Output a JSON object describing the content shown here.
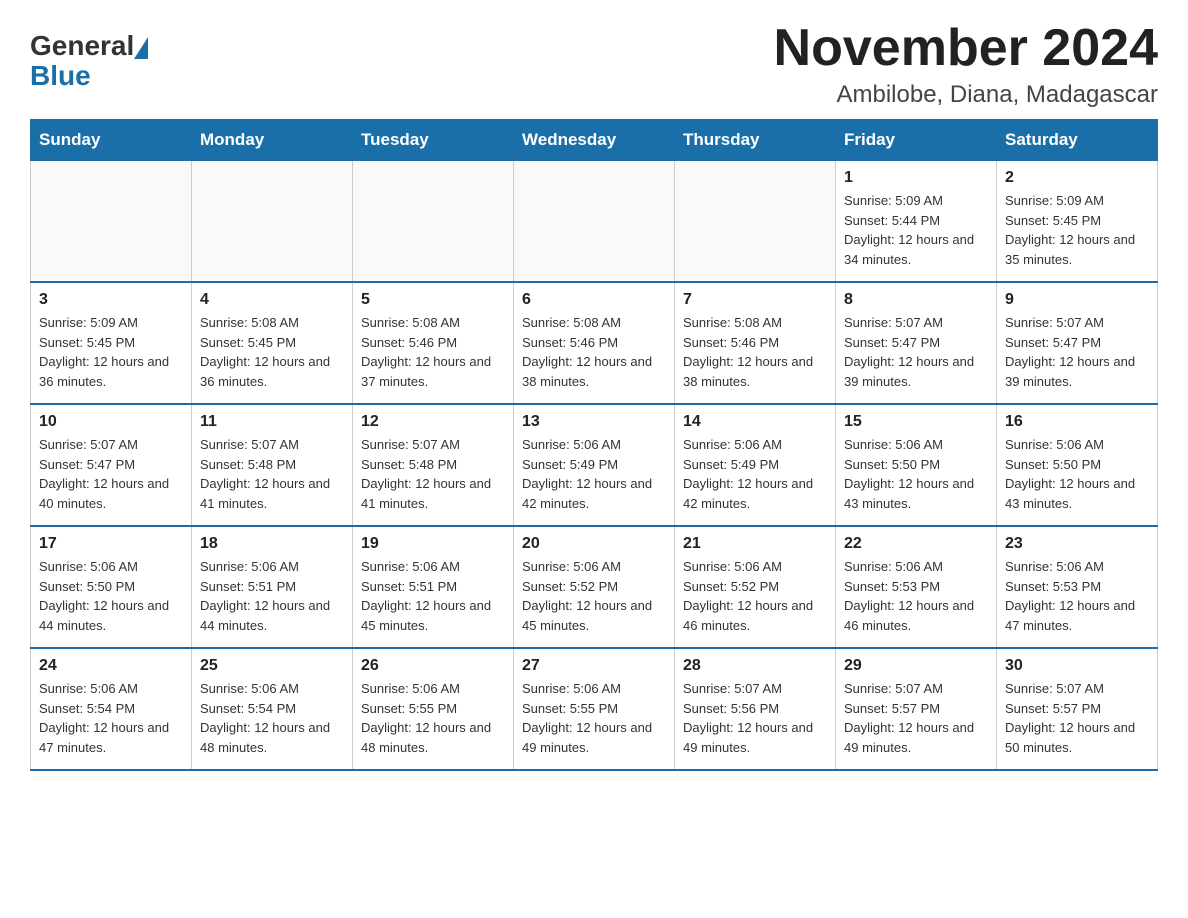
{
  "logo": {
    "text_general": "General",
    "text_blue": "Blue"
  },
  "title": "November 2024",
  "subtitle": "Ambilobe, Diana, Madagascar",
  "days_of_week": [
    "Sunday",
    "Monday",
    "Tuesday",
    "Wednesday",
    "Thursday",
    "Friday",
    "Saturday"
  ],
  "weeks": [
    [
      {
        "day": "",
        "sunrise": "",
        "sunset": "",
        "daylight": "",
        "empty": true
      },
      {
        "day": "",
        "sunrise": "",
        "sunset": "",
        "daylight": "",
        "empty": true
      },
      {
        "day": "",
        "sunrise": "",
        "sunset": "",
        "daylight": "",
        "empty": true
      },
      {
        "day": "",
        "sunrise": "",
        "sunset": "",
        "daylight": "",
        "empty": true
      },
      {
        "day": "",
        "sunrise": "",
        "sunset": "",
        "daylight": "",
        "empty": true
      },
      {
        "day": "1",
        "sunrise": "Sunrise: 5:09 AM",
        "sunset": "Sunset: 5:44 PM",
        "daylight": "Daylight: 12 hours and 34 minutes.",
        "empty": false
      },
      {
        "day": "2",
        "sunrise": "Sunrise: 5:09 AM",
        "sunset": "Sunset: 5:45 PM",
        "daylight": "Daylight: 12 hours and 35 minutes.",
        "empty": false
      }
    ],
    [
      {
        "day": "3",
        "sunrise": "Sunrise: 5:09 AM",
        "sunset": "Sunset: 5:45 PM",
        "daylight": "Daylight: 12 hours and 36 minutes.",
        "empty": false
      },
      {
        "day": "4",
        "sunrise": "Sunrise: 5:08 AM",
        "sunset": "Sunset: 5:45 PM",
        "daylight": "Daylight: 12 hours and 36 minutes.",
        "empty": false
      },
      {
        "day": "5",
        "sunrise": "Sunrise: 5:08 AM",
        "sunset": "Sunset: 5:46 PM",
        "daylight": "Daylight: 12 hours and 37 minutes.",
        "empty": false
      },
      {
        "day": "6",
        "sunrise": "Sunrise: 5:08 AM",
        "sunset": "Sunset: 5:46 PM",
        "daylight": "Daylight: 12 hours and 38 minutes.",
        "empty": false
      },
      {
        "day": "7",
        "sunrise": "Sunrise: 5:08 AM",
        "sunset": "Sunset: 5:46 PM",
        "daylight": "Daylight: 12 hours and 38 minutes.",
        "empty": false
      },
      {
        "day": "8",
        "sunrise": "Sunrise: 5:07 AM",
        "sunset": "Sunset: 5:47 PM",
        "daylight": "Daylight: 12 hours and 39 minutes.",
        "empty": false
      },
      {
        "day": "9",
        "sunrise": "Sunrise: 5:07 AM",
        "sunset": "Sunset: 5:47 PM",
        "daylight": "Daylight: 12 hours and 39 minutes.",
        "empty": false
      }
    ],
    [
      {
        "day": "10",
        "sunrise": "Sunrise: 5:07 AM",
        "sunset": "Sunset: 5:47 PM",
        "daylight": "Daylight: 12 hours and 40 minutes.",
        "empty": false
      },
      {
        "day": "11",
        "sunrise": "Sunrise: 5:07 AM",
        "sunset": "Sunset: 5:48 PM",
        "daylight": "Daylight: 12 hours and 41 minutes.",
        "empty": false
      },
      {
        "day": "12",
        "sunrise": "Sunrise: 5:07 AM",
        "sunset": "Sunset: 5:48 PM",
        "daylight": "Daylight: 12 hours and 41 minutes.",
        "empty": false
      },
      {
        "day": "13",
        "sunrise": "Sunrise: 5:06 AM",
        "sunset": "Sunset: 5:49 PM",
        "daylight": "Daylight: 12 hours and 42 minutes.",
        "empty": false
      },
      {
        "day": "14",
        "sunrise": "Sunrise: 5:06 AM",
        "sunset": "Sunset: 5:49 PM",
        "daylight": "Daylight: 12 hours and 42 minutes.",
        "empty": false
      },
      {
        "day": "15",
        "sunrise": "Sunrise: 5:06 AM",
        "sunset": "Sunset: 5:50 PM",
        "daylight": "Daylight: 12 hours and 43 minutes.",
        "empty": false
      },
      {
        "day": "16",
        "sunrise": "Sunrise: 5:06 AM",
        "sunset": "Sunset: 5:50 PM",
        "daylight": "Daylight: 12 hours and 43 minutes.",
        "empty": false
      }
    ],
    [
      {
        "day": "17",
        "sunrise": "Sunrise: 5:06 AM",
        "sunset": "Sunset: 5:50 PM",
        "daylight": "Daylight: 12 hours and 44 minutes.",
        "empty": false
      },
      {
        "day": "18",
        "sunrise": "Sunrise: 5:06 AM",
        "sunset": "Sunset: 5:51 PM",
        "daylight": "Daylight: 12 hours and 44 minutes.",
        "empty": false
      },
      {
        "day": "19",
        "sunrise": "Sunrise: 5:06 AM",
        "sunset": "Sunset: 5:51 PM",
        "daylight": "Daylight: 12 hours and 45 minutes.",
        "empty": false
      },
      {
        "day": "20",
        "sunrise": "Sunrise: 5:06 AM",
        "sunset": "Sunset: 5:52 PM",
        "daylight": "Daylight: 12 hours and 45 minutes.",
        "empty": false
      },
      {
        "day": "21",
        "sunrise": "Sunrise: 5:06 AM",
        "sunset": "Sunset: 5:52 PM",
        "daylight": "Daylight: 12 hours and 46 minutes.",
        "empty": false
      },
      {
        "day": "22",
        "sunrise": "Sunrise: 5:06 AM",
        "sunset": "Sunset: 5:53 PM",
        "daylight": "Daylight: 12 hours and 46 minutes.",
        "empty": false
      },
      {
        "day": "23",
        "sunrise": "Sunrise: 5:06 AM",
        "sunset": "Sunset: 5:53 PM",
        "daylight": "Daylight: 12 hours and 47 minutes.",
        "empty": false
      }
    ],
    [
      {
        "day": "24",
        "sunrise": "Sunrise: 5:06 AM",
        "sunset": "Sunset: 5:54 PM",
        "daylight": "Daylight: 12 hours and 47 minutes.",
        "empty": false
      },
      {
        "day": "25",
        "sunrise": "Sunrise: 5:06 AM",
        "sunset": "Sunset: 5:54 PM",
        "daylight": "Daylight: 12 hours and 48 minutes.",
        "empty": false
      },
      {
        "day": "26",
        "sunrise": "Sunrise: 5:06 AM",
        "sunset": "Sunset: 5:55 PM",
        "daylight": "Daylight: 12 hours and 48 minutes.",
        "empty": false
      },
      {
        "day": "27",
        "sunrise": "Sunrise: 5:06 AM",
        "sunset": "Sunset: 5:55 PM",
        "daylight": "Daylight: 12 hours and 49 minutes.",
        "empty": false
      },
      {
        "day": "28",
        "sunrise": "Sunrise: 5:07 AM",
        "sunset": "Sunset: 5:56 PM",
        "daylight": "Daylight: 12 hours and 49 minutes.",
        "empty": false
      },
      {
        "day": "29",
        "sunrise": "Sunrise: 5:07 AM",
        "sunset": "Sunset: 5:57 PM",
        "daylight": "Daylight: 12 hours and 49 minutes.",
        "empty": false
      },
      {
        "day": "30",
        "sunrise": "Sunrise: 5:07 AM",
        "sunset": "Sunset: 5:57 PM",
        "daylight": "Daylight: 12 hours and 50 minutes.",
        "empty": false
      }
    ]
  ]
}
